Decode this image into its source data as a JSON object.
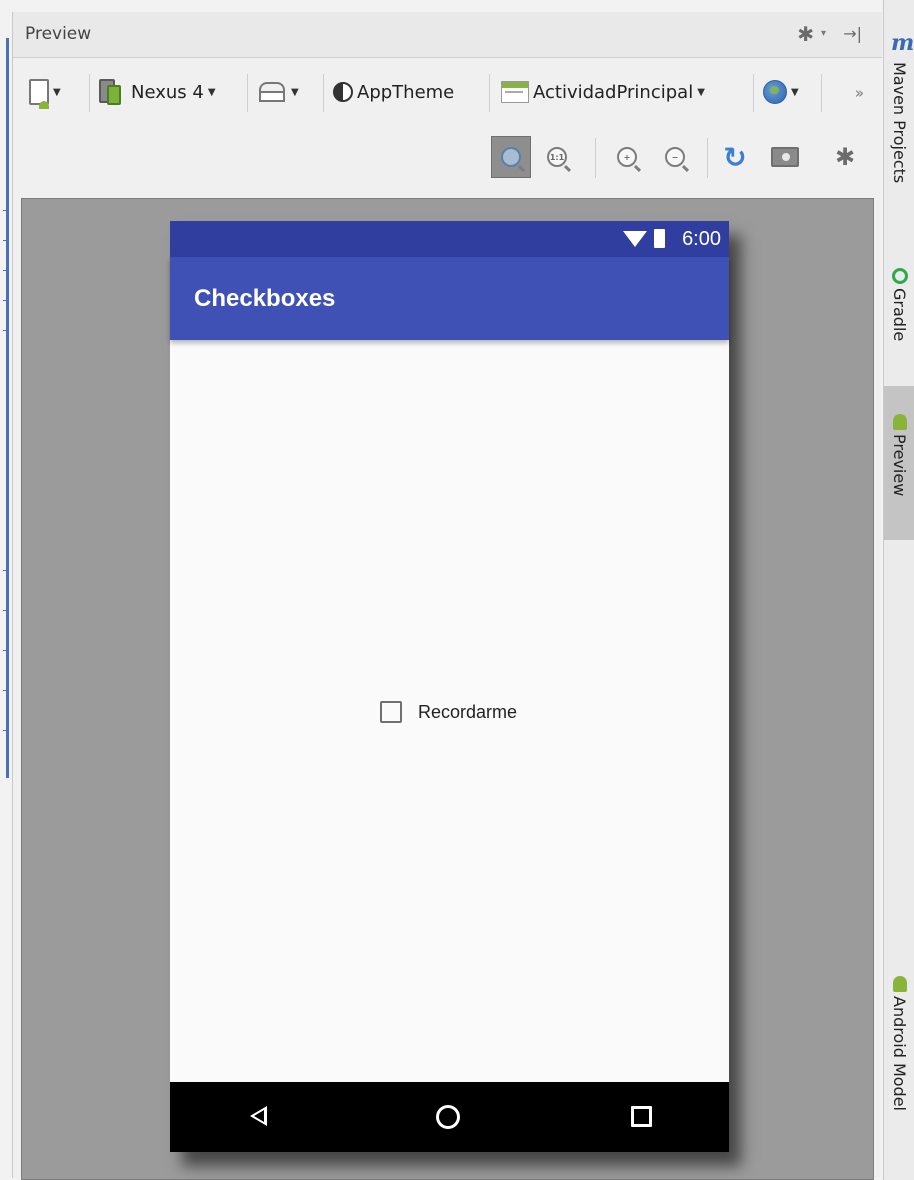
{
  "panel": {
    "title": "Preview"
  },
  "toolbar": {
    "device_name": "Nexus 4",
    "theme_name": "AppTheme",
    "activity_name": "ActividadPrincipal",
    "overflow": "»"
  },
  "phone": {
    "status_time": "6:00",
    "app_title": "Checkboxes",
    "checkbox": {
      "label": "Recordarme",
      "checked": false
    }
  },
  "tool_windows": {
    "maven_label": "Maven Projects",
    "gradle_label": "Gradle",
    "preview_label": "Preview",
    "android_model_label": "Android Model"
  },
  "colors": {
    "status_bar": "#303f9f",
    "app_bar": "#3f51b5",
    "canvas": "#9b9b9b"
  }
}
